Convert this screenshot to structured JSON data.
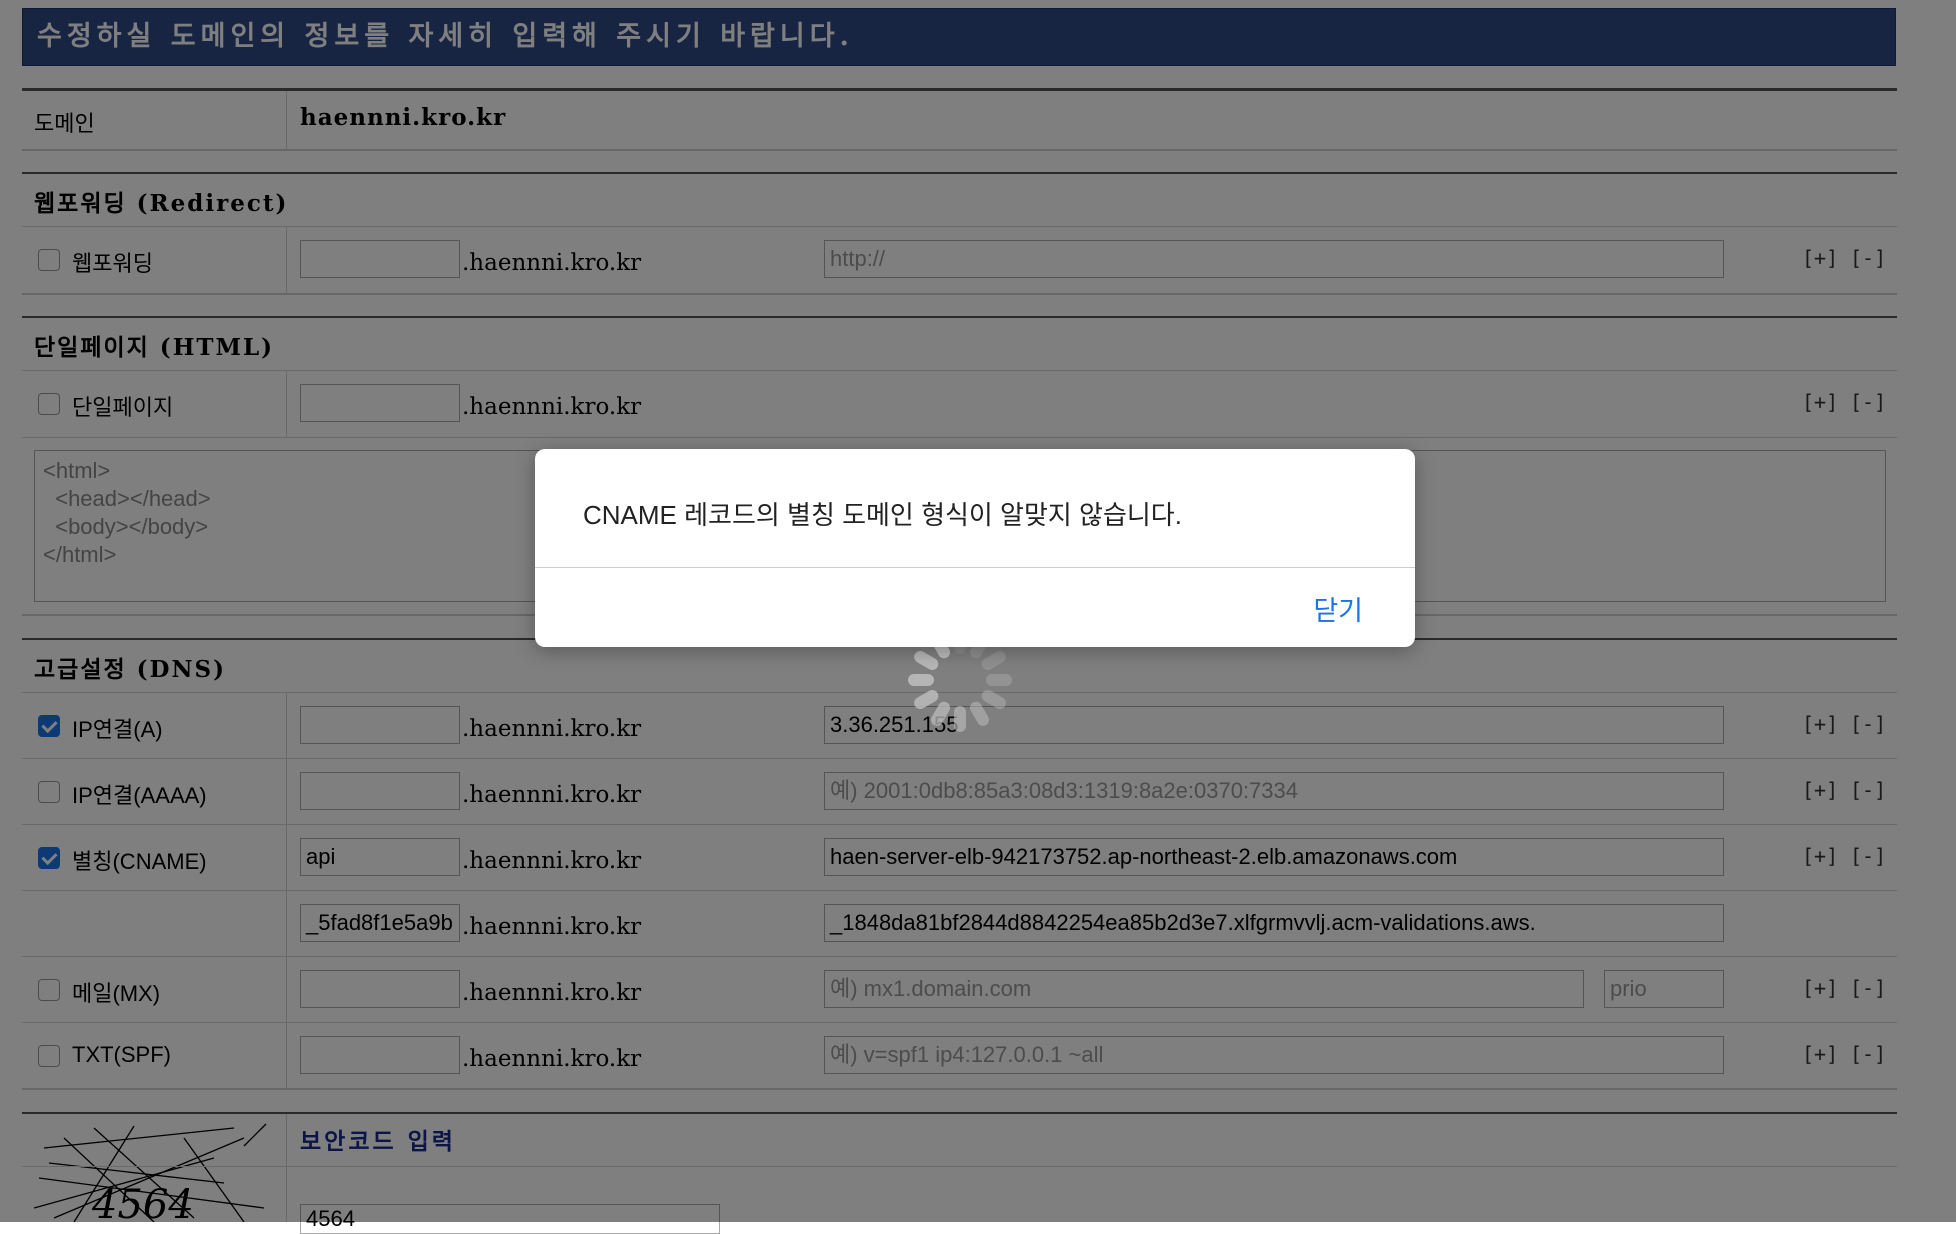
{
  "banner": {
    "text": "수정하실 도메인의 정보를 자세히 입력해 주시기 바랍니다."
  },
  "domain": {
    "label": "도메인",
    "value": "haennni.kro.kr"
  },
  "redirect": {
    "section_title": "웹포워딩 (Redirect)",
    "checkbox_label": "웹포워딩",
    "checked": false,
    "host": "",
    "suffix": ".haennni.kro.kr",
    "url_placeholder": "http://",
    "add": "[+]",
    "remove": "[-]"
  },
  "html_page": {
    "section_title": "단일페이지 (HTML)",
    "checkbox_label": "단일페이지",
    "checked": false,
    "host": "",
    "suffix": ".haennni.kro.kr",
    "textarea_placeholder": "<html>\n  <head></head>\n  <body></body>\n</html>",
    "add": "[+]",
    "remove": "[-]"
  },
  "dns": {
    "section_title": "고급설정 (DNS)",
    "suffix": ".haennni.kro.kr",
    "add": "[+]",
    "remove": "[-]",
    "a": {
      "label": "IP연결(A)",
      "checked": true,
      "host": "",
      "value": "3.36.251.155"
    },
    "aaaa": {
      "label": "IP연결(AAAA)",
      "checked": false,
      "host": "",
      "placeholder": "예) 2001:0db8:85a3:08d3:1319:8a2e:0370:7334"
    },
    "cname": {
      "label": "별칭(CNAME)",
      "checked": true,
      "rows": [
        {
          "host": "api",
          "value": "haen-server-elb-942173752.ap-northeast-2.elb.amazonaws.com"
        },
        {
          "host": "_5fad8f1e5a9b",
          "value": "_1848da81bf2844d8842254ea85b2d3e7.xlfgrmvvlj.acm-validations.aws."
        }
      ]
    },
    "mx": {
      "label": "메일(MX)",
      "checked": false,
      "host": "",
      "placeholder": "예) mx1.domain.com",
      "prio_placeholder": "prio"
    },
    "txt": {
      "label": "TXT(SPF)",
      "checked": false,
      "host": "",
      "placeholder": "예) v=spf1 ip4:127.0.0.1 ~all"
    }
  },
  "captcha": {
    "title": "보안코드 입력",
    "image_text": "4564",
    "input_value": "4564"
  },
  "dialog": {
    "message": "CNAME 레코드의 별칭 도메인 형식이 알맞지 않습니다.",
    "close_label": "닫기"
  }
}
